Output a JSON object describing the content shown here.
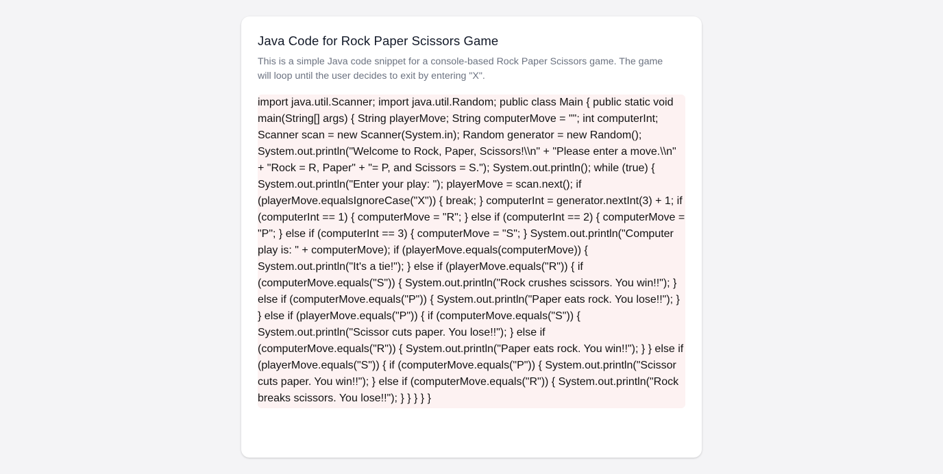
{
  "card": {
    "title": "Java Code for Rock Paper Scissors Game",
    "description": "This is a simple Java code snippet for a console-based Rock Paper Scissors game. The game will loop until the user decides to exit by entering \"X\".",
    "code": "import java.util.Scanner; import java.util.Random; public class Main { public static void main(String[] args) { String playerMove; String computerMove = \"\"; int computerInt; Scanner scan = new Scanner(System.in); Random generator = new Random(); System.out.println(\"Welcome to Rock, Paper, Scissors!\\\\n\" + \"Please enter a move.\\\\n\" + \"Rock = R, Paper\" + \"= P, and Scissors = S.\"); System.out.println(); while (true) { System.out.println(\"Enter your play: \"); playerMove = scan.next(); if (playerMove.equalsIgnoreCase(\"X\")) { break; } computerInt = generator.nextInt(3) + 1; if (computerInt == 1) { computerMove = \"R\"; } else if (computerInt == 2) { computerMove = \"P\"; } else if (computerInt == 3) { computerMove = \"S\"; } System.out.println(\"Computer play is: \" + computerMove); if (playerMove.equals(computerMove)) { System.out.println(\"It's a tie!\"); } else if (playerMove.equals(\"R\")) { if (computerMove.equals(\"S\")) { System.out.println(\"Rock crushes scissors. You win!!\"); } else if (computerMove.equals(\"P\")) { System.out.println(\"Paper eats rock. You lose!!\"); } } else if (playerMove.equals(\"P\")) { if (computerMove.equals(\"S\")) { System.out.println(\"Scissor cuts paper. You lose!!\"); } else if (computerMove.equals(\"R\")) { System.out.println(\"Paper eats rock. You win!!\"); } } else if (playerMove.equals(\"S\")) { if (computerMove.equals(\"P\")) { System.out.println(\"Scissor cuts paper. You win!!\"); } else if (computerMove.equals(\"R\")) { System.out.println(\"Rock breaks scissors. You lose!!\"); } } } } }"
  },
  "colors": {
    "page_background": "#f4f4f6",
    "card_background": "#ffffff",
    "code_background": "#fdf2f2",
    "title_text": "#111827",
    "description_text": "#6b7280"
  }
}
